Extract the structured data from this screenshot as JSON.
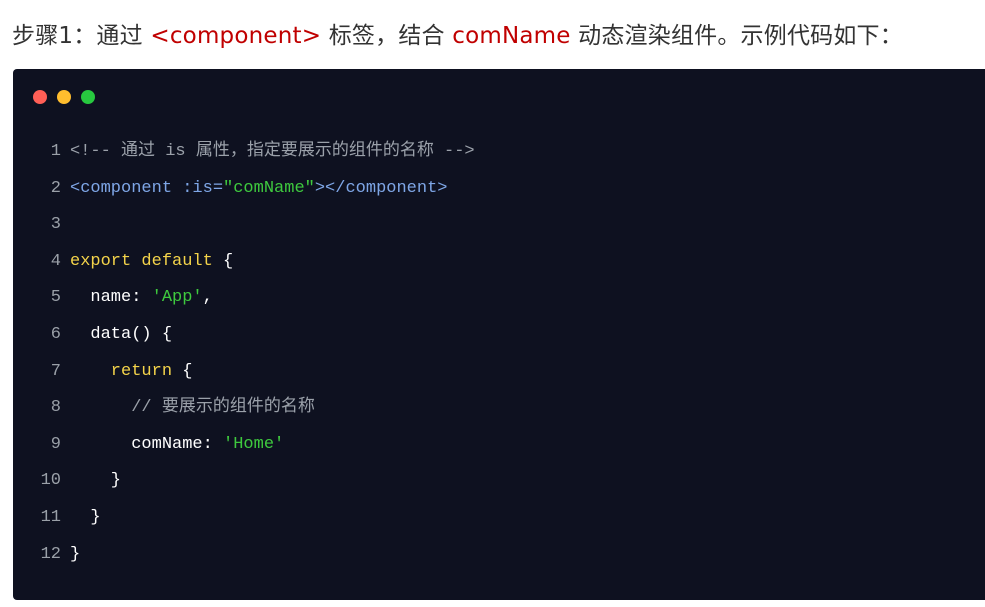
{
  "heading": {
    "p1": "步骤1：通过 ",
    "code1": "<component>",
    "p2": " 标签，结合 ",
    "code2": "comName",
    "p3": " 动态渲染组件。示例代码如下："
  },
  "window_dots": [
    "#ff5f56",
    "#ffbd2e",
    "#27c93f"
  ],
  "code_lines": [
    {
      "n": "1",
      "tokens": [
        {
          "t": "<!-- 通过 is 属性，指定要展示的组件的名称 -->",
          "c": "comment"
        }
      ]
    },
    {
      "n": "2",
      "tokens": [
        {
          "t": "<component :is=",
          "c": "tag"
        },
        {
          "t": "\"comName\"",
          "c": "str"
        },
        {
          "t": "></component>",
          "c": "tag"
        }
      ]
    },
    {
      "n": "3",
      "tokens": []
    },
    {
      "n": "4",
      "tokens": [
        {
          "t": "export default",
          "c": "kw"
        },
        {
          "t": " {",
          "c": "plain"
        }
      ]
    },
    {
      "n": "5",
      "tokens": [
        {
          "t": "  name: ",
          "c": "plain"
        },
        {
          "t": "'App'",
          "c": "str"
        },
        {
          "t": ",",
          "c": "plain"
        }
      ]
    },
    {
      "n": "6",
      "tokens": [
        {
          "t": "  data() {",
          "c": "plain"
        }
      ]
    },
    {
      "n": "7",
      "tokens": [
        {
          "t": "    return",
          "c": "kw"
        },
        {
          "t": " {",
          "c": "plain"
        }
      ]
    },
    {
      "n": "8",
      "tokens": [
        {
          "t": "      // 要展示的组件的名称",
          "c": "comment"
        }
      ]
    },
    {
      "n": "9",
      "tokens": [
        {
          "t": "      comName: ",
          "c": "plain"
        },
        {
          "t": "'Home'",
          "c": "str"
        }
      ]
    },
    {
      "n": "10",
      "tokens": [
        {
          "t": "    }",
          "c": "plain"
        }
      ]
    },
    {
      "n": "11",
      "tokens": [
        {
          "t": "  }",
          "c": "plain"
        }
      ]
    },
    {
      "n": "12",
      "tokens": [
        {
          "t": "}",
          "c": "plain"
        }
      ]
    }
  ]
}
